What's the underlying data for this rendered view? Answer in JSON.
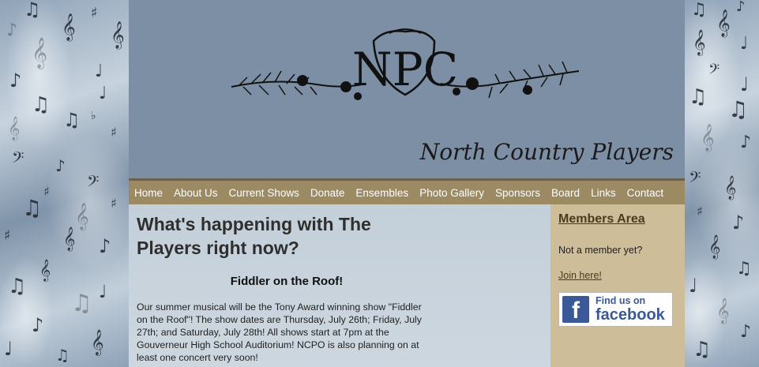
{
  "site": {
    "logo_text": "NPC",
    "title": "North Country Players"
  },
  "nav": {
    "items": [
      {
        "label": "Home"
      },
      {
        "label": "About Us"
      },
      {
        "label": "Current Shows"
      },
      {
        "label": "Donate"
      },
      {
        "label": "Ensembles"
      },
      {
        "label": "Photo Gallery"
      },
      {
        "label": "Sponsors"
      },
      {
        "label": "Board"
      },
      {
        "label": "Links"
      },
      {
        "label": "Contact"
      }
    ]
  },
  "main": {
    "heading": "What's happening with The Players right now?",
    "show_title": "Fiddler on the Roof!",
    "body": "Our summer musical will be the Tony Award winning show \"Fiddler on the Roof\"!  The show dates are Thursday, July 26th; Friday, July 27th; and Saturday, July 28th!  All shows start at 7pm at the Gouverneur High School Auditorium!  NCPO is also planning on at least one concert very soon!"
  },
  "sidebar": {
    "heading": "Members Area",
    "not_member": "Not a member yet?",
    "join_link": "Join here!",
    "facebook": {
      "find": "Find us on",
      "name": "facebook",
      "logo": "f"
    }
  },
  "colors": {
    "header_bg": "#7d8fa5",
    "nav_bg": "#9c8a63",
    "sidebar_bg": "#cdbd98",
    "facebook_blue": "#3b5998"
  }
}
